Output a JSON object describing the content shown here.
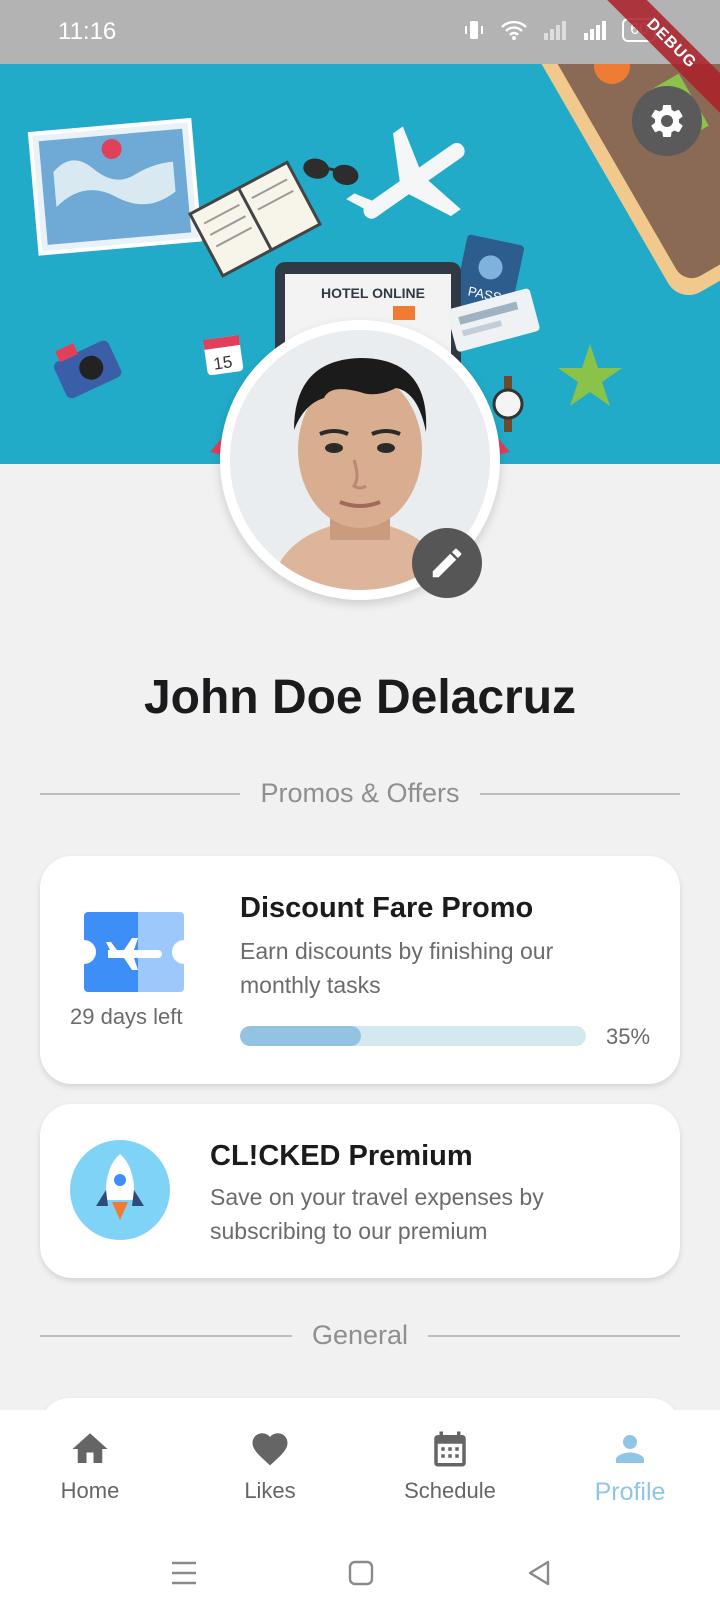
{
  "status_bar": {
    "time": "11:16",
    "battery": "60",
    "debug_banner": "DEBUG"
  },
  "profile": {
    "name": "John Doe Delacruz"
  },
  "sections": {
    "promos_heading": "Promos & Offers",
    "general_heading": "General"
  },
  "promo_card": {
    "title": "Discount Fare Promo",
    "description": "Earn discounts by finishing our monthly tasks",
    "days_left": "29 days left",
    "progress_percent": 35,
    "progress_label": "35%"
  },
  "premium_card": {
    "title": "CL!CKED Premium",
    "description": "Save on your travel expenses by subscribing to our premium"
  },
  "bottom_nav": {
    "items": [
      {
        "label": "Home",
        "icon": "home-icon",
        "active": false
      },
      {
        "label": "Likes",
        "icon": "heart-icon",
        "active": false
      },
      {
        "label": "Schedule",
        "icon": "calendar-icon",
        "active": false
      },
      {
        "label": "Profile",
        "icon": "person-icon",
        "active": true
      }
    ]
  },
  "colors": {
    "hero_bg": "#22abc8",
    "accent": "#8fc6e5",
    "progress_fill": "#94c3e2",
    "progress_track": "#d4e9ef"
  }
}
